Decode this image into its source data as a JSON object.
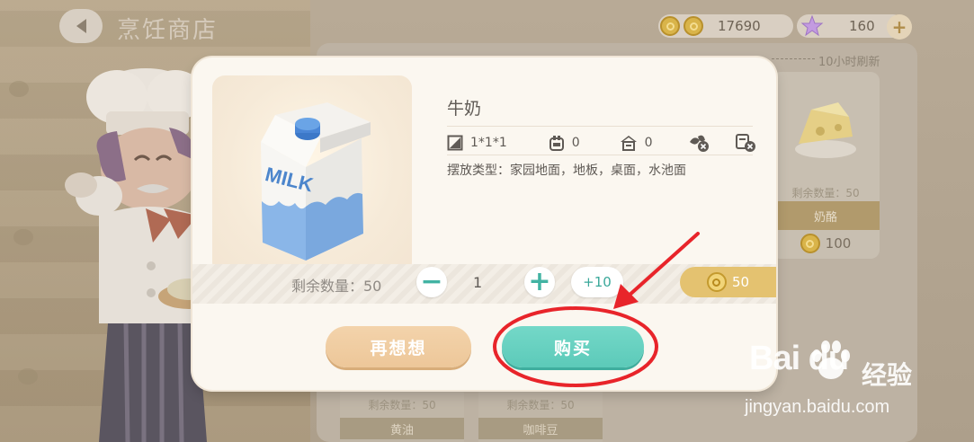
{
  "header": {
    "shop_title": "烹饪商店"
  },
  "currency": {
    "coins": "17690",
    "stars": "160",
    "add_label": "+"
  },
  "background_shop": {
    "refresh_text": "10小时刷新",
    "cards": [
      {
        "remaining": "剩余数量：50",
        "name": "奶酪",
        "price": "100"
      }
    ],
    "bottom_cards": [
      {
        "remaining": "剩余数量：50",
        "name": "黄油"
      },
      {
        "remaining": "剩余数量：50",
        "name": "咖啡豆"
      }
    ]
  },
  "modal": {
    "item_name": "牛奶",
    "stats": {
      "size": "1*1*1",
      "comfort": "0",
      "house": "0"
    },
    "placement_label": "摆放类型：家园地面，地板，桌面，水池面",
    "remaining_label": "剩余数量：50",
    "minus_label": "−",
    "quantity": "1",
    "plus_label": "+",
    "plus10_label": "+10",
    "price": "50",
    "rethink_button": "再想想",
    "buy_button": "购买",
    "carton_text": "MILK"
  },
  "annotation": {
    "color": "#e8242a"
  },
  "watermark": {
    "logo": "Bai du",
    "cn": "经验",
    "url": "jingyan.baidu.com"
  }
}
